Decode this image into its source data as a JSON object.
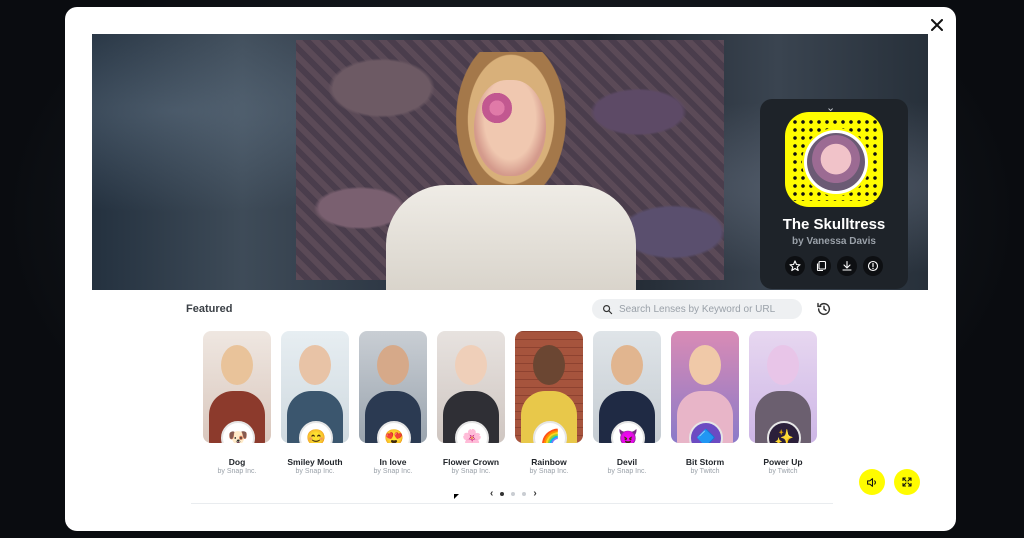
{
  "lens_card": {
    "title": "The Skulltress",
    "author": "by Vanessa Davis"
  },
  "featured": {
    "label": "Featured"
  },
  "search": {
    "placeholder": "Search Lenses by Keyword or URL"
  },
  "lenses": [
    {
      "name": "Dog",
      "by": "by Snap Inc.",
      "icon": "dog-face-icon"
    },
    {
      "name": "Smiley Mouth",
      "by": "by Snap Inc.",
      "icon": "smiley-icon"
    },
    {
      "name": "In love",
      "by": "by Snap Inc.",
      "icon": "heart-eyes-icon"
    },
    {
      "name": "Flower Crown",
      "by": "by Snap Inc.",
      "icon": "flower-icon"
    },
    {
      "name": "Rainbow",
      "by": "by Snap Inc.",
      "icon": "rainbow-icon"
    },
    {
      "name": "Devil",
      "by": "by Snap Inc.",
      "icon": "devil-icon"
    },
    {
      "name": "Bit Storm",
      "by": "by Twitch",
      "icon": "bit-storm-icon"
    },
    {
      "name": "Power Up",
      "by": "by Twitch",
      "icon": "power-up-icon"
    }
  ],
  "pager": {
    "pages": 3,
    "current": 1
  },
  "colors": {
    "accent": "#fffc00",
    "card_bg": "#1e2329"
  }
}
